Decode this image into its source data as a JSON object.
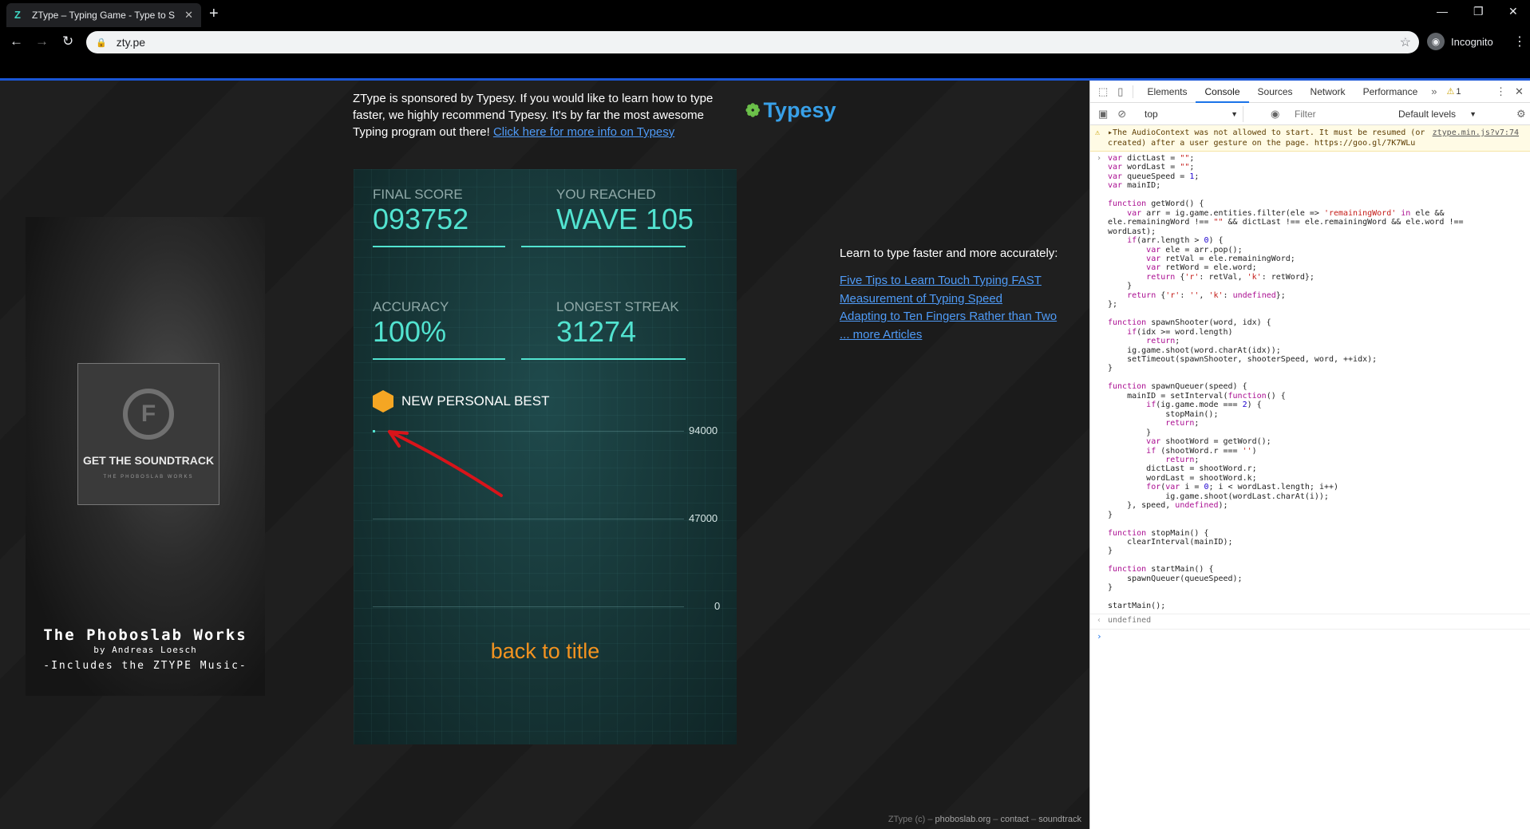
{
  "browser": {
    "tab_title": "ZType – Typing Game - Type to S",
    "favicon": "Z",
    "url": "zty.pe",
    "incognito_label": "Incognito"
  },
  "page": {
    "sponsor_text": "ZType is sponsored by Typesy. If you would like to learn how to type faster, we highly recommend Typesy. It's by far the most awesome Typing program out there! ",
    "sponsor_link": "Click here for more info on Typesy",
    "typesy_logo": "Typesy",
    "soundtrack": {
      "button": "GET THE SOUNDTRACK",
      "box_sub": "THE PHOBOSLAB WORKS",
      "title": "The Phoboslab Works",
      "author": "by Andreas Loesch",
      "includes": "-Includes the ZTYPE Music-"
    },
    "game": {
      "final_score_label": "FINAL SCORE",
      "final_score": "093752",
      "reached_label": "YOU REACHED",
      "reached_value": "WAVE 105",
      "accuracy_label": "ACCURACY",
      "accuracy": "100%",
      "streak_label": "LONGEST STREAK",
      "streak": "31274",
      "personal_best": "NEW PERSONAL BEST",
      "graph_max": "94000",
      "graph_mid": "47000",
      "graph_min": "0",
      "back_to_title": "back to title"
    },
    "learn_heading": "Learn to type faster and more accurately:",
    "articles": [
      "Five Tips to Learn Touch Typing FAST",
      "Measurement of Typing Speed",
      "Adapting to Ten Fingers Rather than Two",
      "... more Articles"
    ],
    "footer": {
      "prefix": "ZType (c) – ",
      "phoboslab": "phoboslab.org",
      "sep1": " – ",
      "contact": "contact",
      "sep2": " – ",
      "soundtrack": "soundtrack"
    }
  },
  "devtools": {
    "tabs": [
      "Elements",
      "Console",
      "Sources",
      "Network",
      "Performance"
    ],
    "active_tab": "Console",
    "warning_count": "1",
    "context": "top",
    "filter_placeholder": "Filter",
    "levels": "Default levels",
    "warning_text": "▸The AudioContext was not allowed to start. It must be resumed (or created) after a user gesture on the page. https://goo.gl/7K7WLu",
    "warning_source": "ztype.min.js?v7:74",
    "result": "undefined"
  },
  "colors": {
    "accent_teal": "#52e3d0",
    "orange": "#f39320",
    "link_blue": "#4f9bf7"
  }
}
